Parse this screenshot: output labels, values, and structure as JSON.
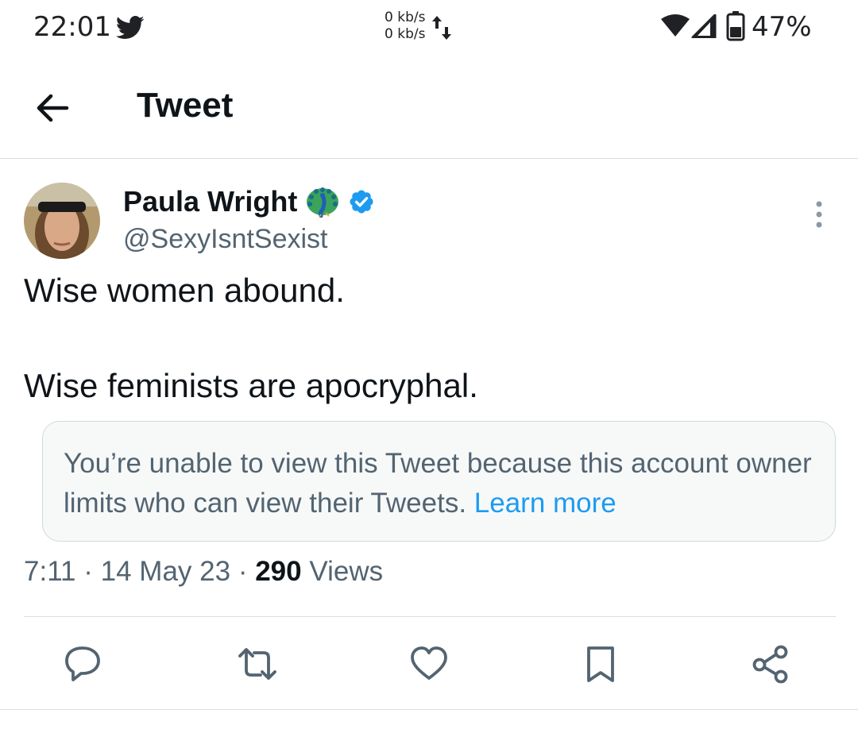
{
  "status_bar": {
    "time": "22:01",
    "net_up": "0 kb/s",
    "net_down": "0 kb/s",
    "battery": "47%",
    "icons": [
      "twitter-bird-icon",
      "data-arrows-icon",
      "wifi-icon",
      "signal-icon",
      "battery-icon"
    ]
  },
  "header": {
    "title": "Tweet",
    "back_icon": "back-arrow-icon"
  },
  "tweet": {
    "author_name": "Paula Wright",
    "author_handle": "@SexyIsntSexist",
    "badges": [
      "peacock-icon",
      "verified-badge-icon"
    ],
    "text_line1": "Wise women abound.",
    "text_line2": "Wise feminists are apocryphal.",
    "notice_text": "You’re unable to view this Tweet because this account owner limits who can view their Tweets.",
    "notice_link": "Learn more",
    "time": "7:11",
    "date": "14 May 23",
    "views_count": "290",
    "views_label": "Views",
    "separator": "·"
  },
  "actions": [
    {
      "name": "reply",
      "icon": "reply-icon"
    },
    {
      "name": "retweet",
      "icon": "retweet-icon"
    },
    {
      "name": "like",
      "icon": "heart-icon"
    },
    {
      "name": "bookmark",
      "icon": "bookmark-icon"
    },
    {
      "name": "share",
      "icon": "share-icon"
    }
  ],
  "colors": {
    "text_primary": "#0f1419",
    "text_secondary": "#536471",
    "link": "#1d9bf0",
    "verified": "#1d9bf0",
    "notice_bg": "#f7f9f9",
    "border": "#dadde1"
  }
}
